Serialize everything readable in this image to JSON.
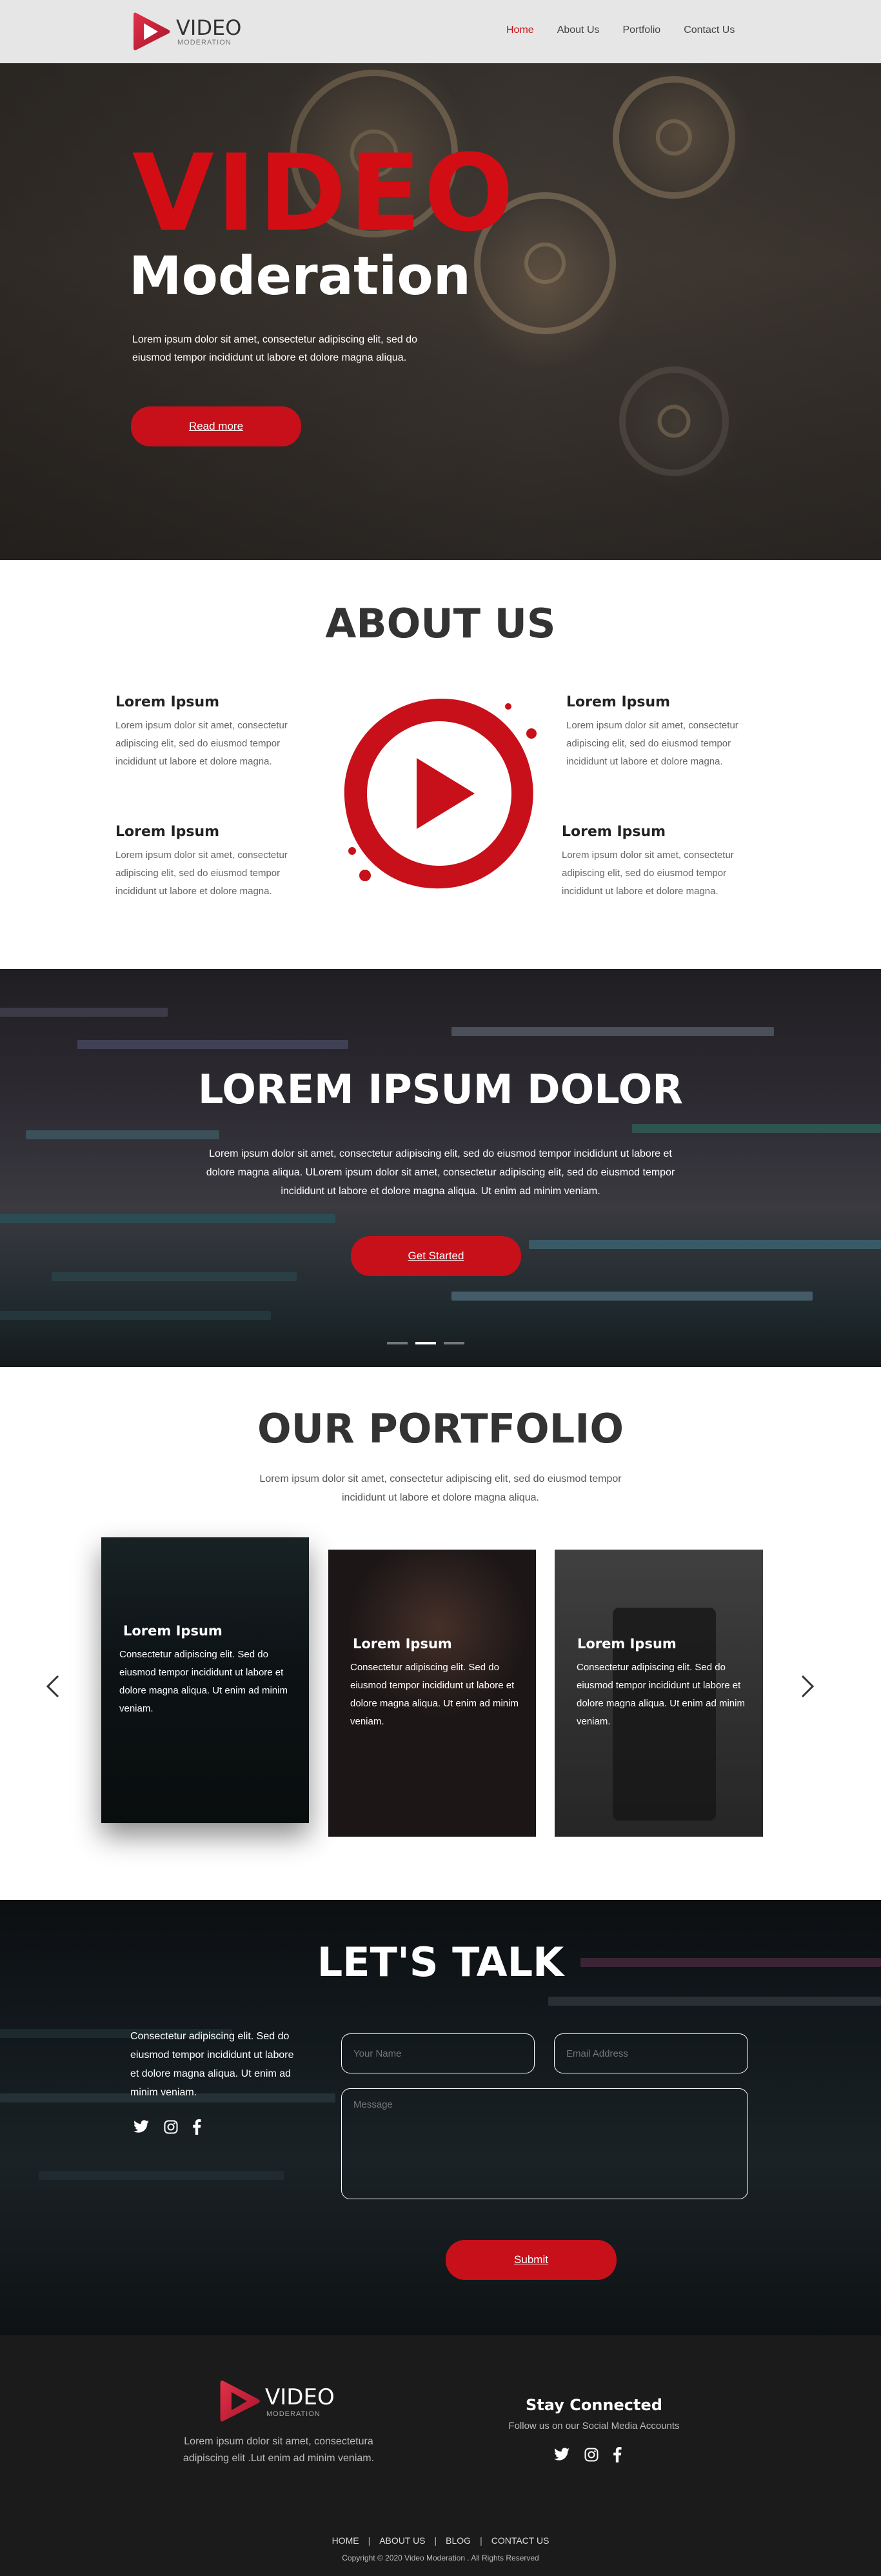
{
  "colors": {
    "accent": "#c8101a",
    "nav_bg": "#e6e6e6",
    "footer_bg": "#1b1b1b"
  },
  "nav": {
    "logo_title": "VIDEO",
    "logo_subtitle": "MODERATION",
    "menu": [
      "Home",
      "About Us",
      "Portfolio",
      "Contact Us"
    ],
    "active_item": "Home"
  },
  "hero": {
    "title_line1": "VIDEO",
    "title_line2": "Moderation",
    "text": "Lorem ipsum dolor sit amet, consectetur adipiscing elit, sed do eiusmod tempor incididunt ut labore et dolore magna aliqua.",
    "button": "Read more"
  },
  "about": {
    "title": "ABOUT US",
    "items": [
      {
        "heading": "Lorem Ipsum",
        "text": "Lorem ipsum dolor sit amet, consectetur adipiscing elit, sed do eiusmod tempor incididunt ut labore et dolore magna."
      },
      {
        "heading": "Lorem Ipsum",
        "text": "Lorem ipsum dolor sit amet, consectetur adipiscing elit, sed do eiusmod tempor incididunt ut labore et dolore magna."
      },
      {
        "heading": "Lorem Ipsum",
        "text": "Lorem ipsum dolor sit amet, consectetur adipiscing elit, sed do eiusmod tempor incididunt ut labore et dolore magna."
      },
      {
        "heading": "Lorem Ipsum",
        "text": "Lorem ipsum dolor sit amet, consectetur adipiscing elit, sed do eiusmod tempor incididunt ut labore et dolore magna."
      }
    ],
    "icon": "play-icon"
  },
  "banner": {
    "title": "LOREM IPSUM DOLOR",
    "text": "Lorem ipsum dolor sit amet, consectetur adipiscing elit, sed do eiusmod tempor incididunt ut labore et dolore magna aliqua. ULorem ipsum dolor sit amet, consectetur adipiscing elit, sed do eiusmod tempor incididunt ut labore et dolore magna aliqua. Ut enim ad minim veniam.",
    "button": "Get Started",
    "slides": 3,
    "active_slide": 2
  },
  "portfolio": {
    "title": "OUR PORTFOLIO",
    "text": "Lorem ipsum dolor sit amet, consectetur adipiscing elit, sed do eiusmod tempor incididunt ut labore et dolore magna aliqua.",
    "cards": [
      {
        "heading": "Lorem Ipsum",
        "text": "Consectetur adipiscing elit. Sed do eiusmod tempor incididunt ut labore et dolore magna aliqua. Ut enim ad minim veniam."
      },
      {
        "heading": "Lorem Ipsum",
        "text": "Consectetur adipiscing elit. Sed do eiusmod tempor incididunt ut labore et dolore magna aliqua. Ut enim ad minim veniam."
      },
      {
        "heading": "Lorem Ipsum",
        "text": "Consectetur adipiscing elit. Sed do eiusmod tempor incididunt ut labore et dolore magna aliqua. Ut enim ad minim veniam."
      }
    ],
    "prev_icon": "chevron-left-icon",
    "next_icon": "chevron-right-icon"
  },
  "contact": {
    "title": "LET'S TALK",
    "text": "Consectetur adipiscing elit. Sed do eiusmod tempor incididunt ut labore et dolore magna aliqua. Ut enim ad minim veniam.",
    "social_icons": [
      "twitter-icon",
      "instagram-icon",
      "facebook-icon"
    ],
    "name_placeholder": "Your Name",
    "email_placeholder": "Email Address",
    "message_placeholder": "Message",
    "submit": "Submit"
  },
  "footer": {
    "logo_title": "VIDEO",
    "logo_subtitle": "MODERATION",
    "description": "Lorem ipsum dolor sit amet, consectetura adipiscing elit .Lut enim ad minim veniam.",
    "stay_title": "Stay Connected",
    "stay_subtitle": "Follow us on our Social Media Accounts",
    "links": [
      "HOME",
      "ABOUT US",
      "BLOG",
      "CONTACT US"
    ],
    "copyright": "Copyright © 2020 Video Moderation . All Rights Reserved"
  }
}
